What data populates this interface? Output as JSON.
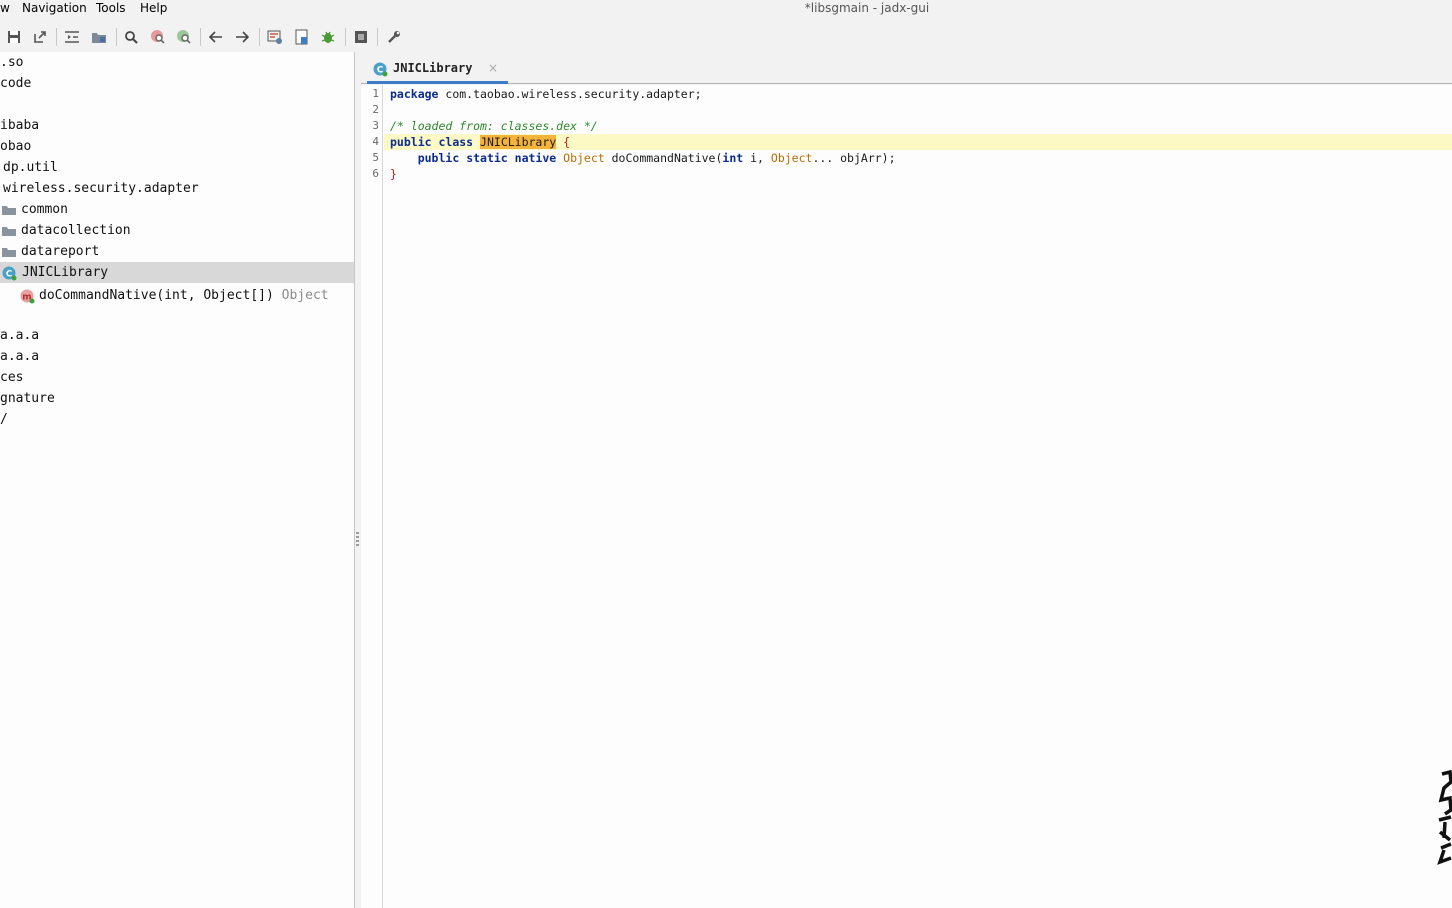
{
  "window": {
    "title": "*libsgmain - jadx-gui"
  },
  "menu": {
    "items": [
      "w",
      "Navigation",
      "Tools",
      "Help"
    ]
  },
  "toolbar": {
    "icons": [
      "save-all-icon",
      "export-icon",
      "sync-tree-icon",
      "flatten-packages-icon",
      "text-search-icon",
      "class-search-icon",
      "usage-search-icon",
      "back-icon",
      "forward-icon",
      "deobfuscation-icon",
      "quark-icon",
      "debug-icon",
      "log-viewer-icon",
      "preferences-icon"
    ]
  },
  "tree": {
    "items": [
      {
        "text": ".so",
        "icon": ""
      },
      {
        "text": " code",
        "icon": ""
      },
      {
        "text": "ibaba",
        "icon": ""
      },
      {
        "text": "obao",
        "icon": ""
      },
      {
        "text": "dp.util",
        "icon": ""
      },
      {
        "text": "wireless.security.adapter",
        "icon": ""
      },
      {
        "text": "common",
        "icon": "package-icon"
      },
      {
        "text": "datacollection",
        "icon": "package-icon"
      },
      {
        "text": "datareport",
        "icon": "package-icon"
      },
      {
        "text": "JNICLibrary",
        "icon": "class-icon",
        "selected": true
      },
      {
        "text": "doCommandNative(int, Object[])",
        "return_type": "Object",
        "icon": "method-icon"
      },
      {
        "text": "a.a.a",
        "icon": ""
      },
      {
        "text": "a.a.a",
        "icon": ""
      },
      {
        "text": "ces",
        "icon": ""
      },
      {
        "text": "gnature",
        "icon": ""
      },
      {
        "text": "/",
        "icon": ""
      }
    ]
  },
  "tab": {
    "label": "JNICLibrary",
    "close": "×"
  },
  "code": {
    "line_numbers": [
      "1",
      "2",
      "3",
      "4",
      "5",
      "6"
    ],
    "line1": {
      "kw": "package",
      "rest": " com.taobao.wireless.security.adapter;"
    },
    "line3": {
      "comment": "/* loaded from: classes.dex */"
    },
    "line4": {
      "kw1": "public",
      "kw2": "class",
      "name": "JNICLibrary",
      "brace": "{"
    },
    "line5": {
      "kw1": "public",
      "kw2": "static",
      "kw3": "native",
      "type1": "Object",
      "mid": " doCommandNative(",
      "kw4": "int",
      "mid2": " i, ",
      "type2": "Object",
      "rest": "... objArr);"
    },
    "line6": {
      "brace": "}"
    }
  },
  "colors": {
    "accent": "#3e7cc6",
    "keyword": "#0b2c8f",
    "comment": "#2c8a2c",
    "type": "#b86d00",
    "selection": "#f4b43c",
    "current_line": "#fcf9c4"
  }
}
